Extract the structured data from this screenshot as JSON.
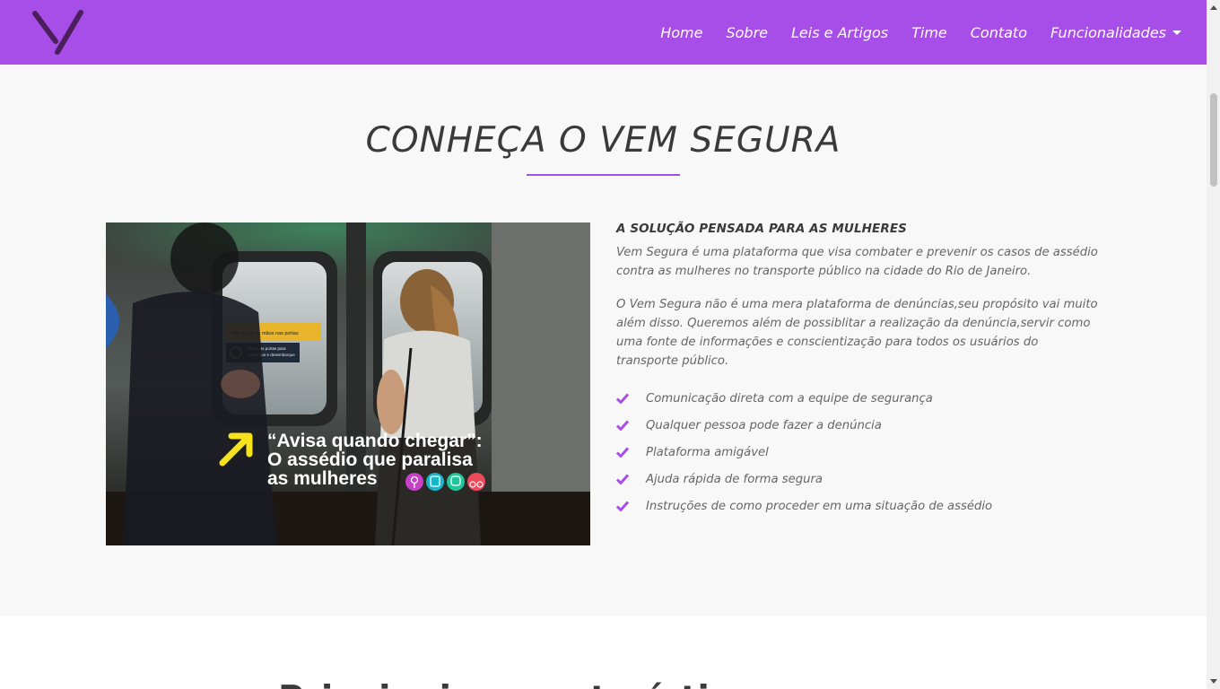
{
  "brand": {
    "accent": "#a84ee8",
    "logo_icon": "v-logo-icon"
  },
  "nav": {
    "items": [
      {
        "label": "Home"
      },
      {
        "label": "Sobre"
      },
      {
        "label": "Leis e Artigos"
      },
      {
        "label": "Time"
      },
      {
        "label": "Contato"
      },
      {
        "label": "Funcionalidades",
        "dropdown": true
      }
    ]
  },
  "about": {
    "title": "CONHEÇA O VEM SEGURA",
    "subtitle": "A SOLUÇÃO PENSADA PARA AS MULHERES",
    "paragraphs": [
      "Vem Segura é uma plataforma que visa combater e prevenir os casos de assédio contra as mulheres no transporte público na cidade do Rio de Janeiro.",
      "O Vem Segura não é uma mera plataforma de denúncias,seu propósito vai muito além disso. Queremos além de possiblitar a realização da denúncia,servir como uma fonte de informações e conscientização para todos os usuários do transporte público."
    ],
    "features": [
      "Comunicação direta com a equipe de segurança",
      "Qualquer pessoa pode fazer a denúncia",
      "Plataforma amigável",
      "Ajuda rápida de forma segura",
      "Instruções de como proceder em uma situação de assédio"
    ],
    "image": {
      "headline_line1": "“Avisa quando chegar”:",
      "headline_line2": "O assédio que paralisa",
      "headline_line3": "as mulheres",
      "sign_text_1": "Não apoie as mãos nas portas",
      "sign_text_2": "Libere as portas para embarque e desembarque"
    }
  },
  "next_section": {
    "title": "Principais características"
  }
}
